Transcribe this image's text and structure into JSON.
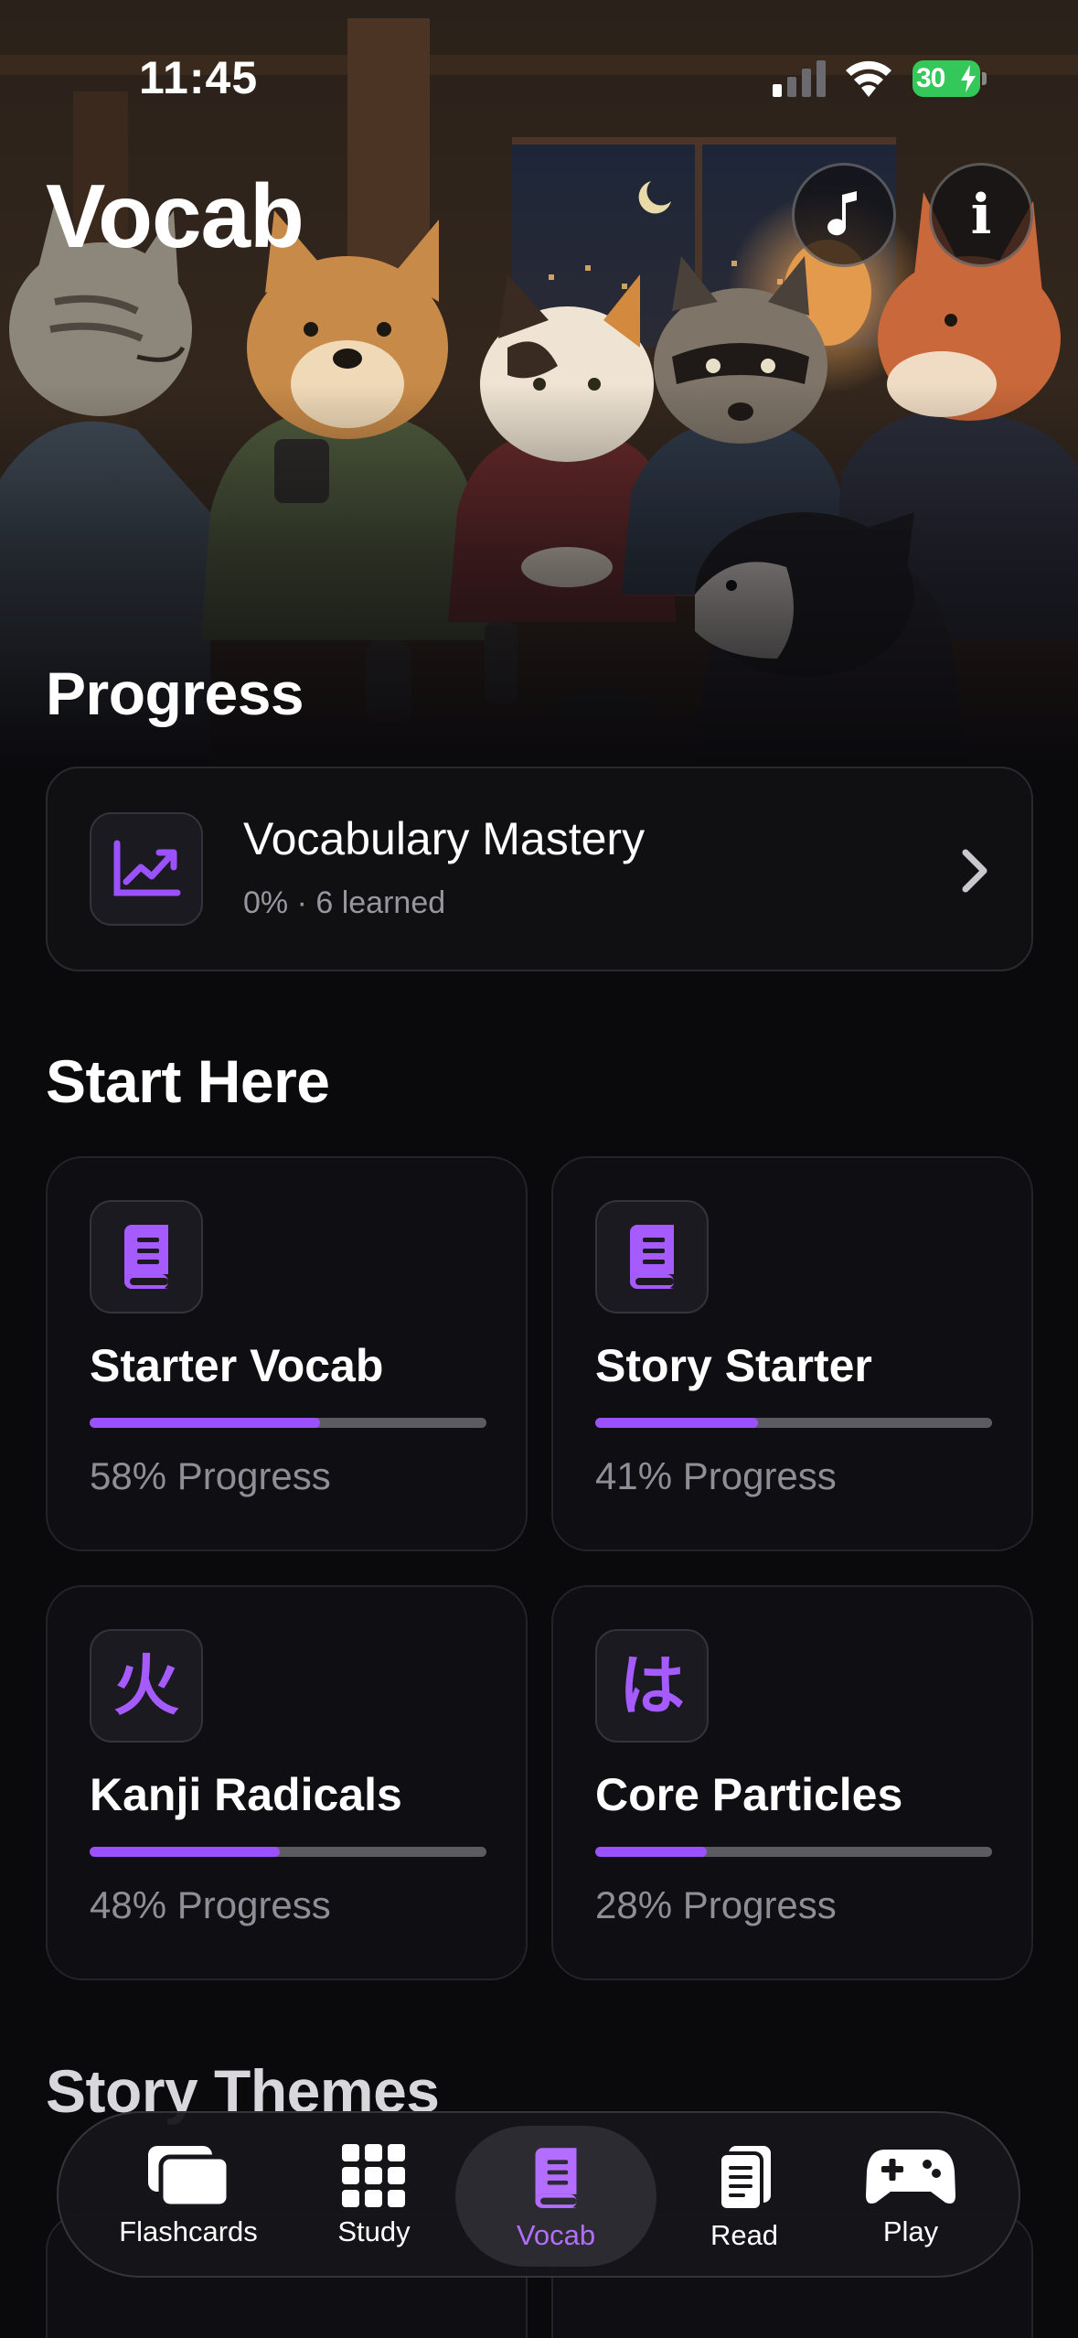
{
  "status_bar": {
    "time": "11:45",
    "battery": "30"
  },
  "header": {
    "title": "Vocab",
    "music_icon": "music-note-icon",
    "info_label": "i"
  },
  "progress": {
    "heading": "Progress",
    "card": {
      "title": "Vocabulary Mastery",
      "subtitle": "0% · 6 learned",
      "icon": "chart-trend-icon"
    }
  },
  "start_here": {
    "heading": "Start Here",
    "decks": [
      {
        "title": "Starter Vocab",
        "progress": 0.58,
        "progress_text": "58% Progress",
        "icon": "book-icon"
      },
      {
        "title": "Story Starter",
        "progress": 0.41,
        "progress_text": "41% Progress",
        "icon": "book-icon"
      },
      {
        "title": "Kanji Radicals",
        "progress": 0.48,
        "progress_text": "48% Progress",
        "glyph": "火"
      },
      {
        "title": "Core Particles",
        "progress": 0.28,
        "progress_text": "28% Progress",
        "glyph": "は"
      }
    ]
  },
  "story_themes": {
    "heading": "Story Themes"
  },
  "tab_bar": {
    "active": "Vocab",
    "tabs": [
      {
        "label": "Flashcards",
        "icon": "flashcards-icon"
      },
      {
        "label": "Study",
        "icon": "grid-icon"
      },
      {
        "label": "Vocab",
        "icon": "book-icon"
      },
      {
        "label": "Read",
        "icon": "document-icon"
      },
      {
        "label": "Play",
        "icon": "gamepad-icon"
      }
    ]
  },
  "colors": {
    "accent": "#9b51ff",
    "background": "#0a090c",
    "battery": "#34c759"
  }
}
